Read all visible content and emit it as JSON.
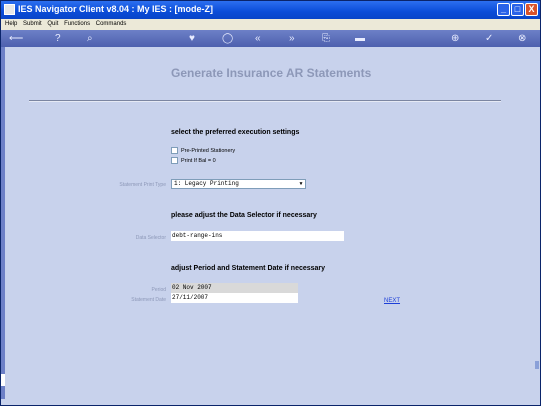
{
  "window": {
    "title": "IES Navigator Client v8.04 : My IES :     [mode-Z]",
    "min": "_",
    "max": "□",
    "close": "X"
  },
  "menu": {
    "items": [
      "Help",
      "Submit",
      "Quit",
      "Functions",
      "Commands"
    ]
  },
  "toolbar": {
    "back": "⟵",
    "help": "?",
    "search": "⌕",
    "heart": "♥",
    "circle": "◯",
    "prev": "«",
    "next": "»",
    "copy": "⎘",
    "doc": "▬",
    "printer": "⊕",
    "check": "✓",
    "close": "⊗"
  },
  "page": {
    "title": "Generate Insurance AR Statements",
    "section1": "select the preferred execution settings",
    "checkboxes": [
      "Pre-Printed Stationery",
      "Print If Bal = 0"
    ],
    "print_type_label": "Statement Print Type",
    "print_type_value": "1: Legacy Printing",
    "section2": "please adjust the Data Selector if necessary",
    "data_selector_label": "Data Selector",
    "data_selector_value": "debt-range-ins",
    "section3": "adjust Period and Statement Date if necessary",
    "period_label": "Period",
    "period_value": "02 Nov 2007",
    "statement_date_label": "Statement Date",
    "statement_date_value": "27/11/2007",
    "next_link": "NEXT"
  }
}
